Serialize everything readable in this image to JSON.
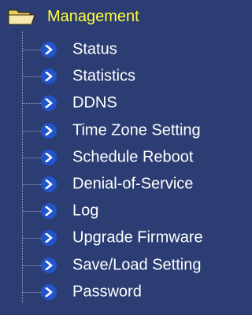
{
  "menu": {
    "root": {
      "label": "Management",
      "icon": "folder-open-icon"
    },
    "items": [
      {
        "label": "Status",
        "icon": "chevron-right-icon"
      },
      {
        "label": "Statistics",
        "icon": "chevron-right-icon"
      },
      {
        "label": "DDNS",
        "icon": "chevron-right-icon"
      },
      {
        "label": "Time Zone Setting",
        "icon": "chevron-right-icon"
      },
      {
        "label": "Schedule Reboot",
        "icon": "chevron-right-icon"
      },
      {
        "label": "Denial-of-Service",
        "icon": "chevron-right-icon"
      },
      {
        "label": "Log",
        "icon": "chevron-right-icon"
      },
      {
        "label": "Upgrade Firmware",
        "icon": "chevron-right-icon"
      },
      {
        "label": "Save/Load Setting",
        "icon": "chevron-right-icon"
      },
      {
        "label": "Password",
        "icon": "chevron-right-icon"
      }
    ]
  },
  "colors": {
    "background": "#2b3d73",
    "root_label": "#ffff40",
    "item_label": "#ffffff",
    "arrow_bullet": "#2255cc"
  }
}
